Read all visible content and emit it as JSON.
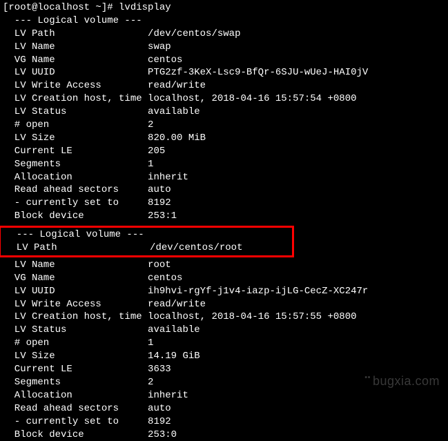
{
  "prompt": "[root@localhost ~]# ",
  "command": "lvdisplay",
  "volumes": [
    {
      "header": "  --- Logical volume ---",
      "fields": [
        {
          "label": "  LV Path               ",
          "value": "/dev/centos/swap"
        },
        {
          "label": "  LV Name               ",
          "value": "swap"
        },
        {
          "label": "  VG Name               ",
          "value": "centos"
        },
        {
          "label": "  LV UUID               ",
          "value": "PTG2zf-3KeX-Lsc9-BfQr-6SJU-wUeJ-HAI0jV"
        },
        {
          "label": "  LV Write Access       ",
          "value": "read/write"
        },
        {
          "label": "  LV Creation host, time",
          "value": "localhost, 2018-04-16 15:57:54 +0800"
        },
        {
          "label": "  LV Status             ",
          "value": "available"
        },
        {
          "label": "  # open                ",
          "value": "2"
        },
        {
          "label": "  LV Size               ",
          "value": "820.00 MiB"
        },
        {
          "label": "  Current LE            ",
          "value": "205"
        },
        {
          "label": "  Segments              ",
          "value": "1"
        },
        {
          "label": "  Allocation            ",
          "value": "inherit"
        },
        {
          "label": "  Read ahead sectors    ",
          "value": "auto"
        },
        {
          "label": "  - currently set to    ",
          "value": "8192"
        },
        {
          "label": "  Block device          ",
          "value": "253:1"
        }
      ]
    },
    {
      "header": "  --- Logical volume ---",
      "highlighted_field": {
        "label": "  LV Path               ",
        "value": "/dev/centos/root"
      },
      "fields": [
        {
          "label": "  LV Name               ",
          "value": "root"
        },
        {
          "label": "  VG Name               ",
          "value": "centos"
        },
        {
          "label": "  LV UUID               ",
          "value": "ih9hvi-rgYf-j1v4-iazp-ijLG-CecZ-XC247r"
        },
        {
          "label": "  LV Write Access       ",
          "value": "read/write"
        },
        {
          "label": "  LV Creation host, time",
          "value": "localhost, 2018-04-16 15:57:55 +0800"
        },
        {
          "label": "  LV Status             ",
          "value": "available"
        },
        {
          "label": "  # open                ",
          "value": "1"
        },
        {
          "label": "  LV Size               ",
          "value": "14.19 GiB"
        },
        {
          "label": "  Current LE            ",
          "value": "3633"
        },
        {
          "label": "  Segments              ",
          "value": "2"
        },
        {
          "label": "  Allocation            ",
          "value": "inherit"
        },
        {
          "label": "  Read ahead sectors    ",
          "value": "auto"
        },
        {
          "label": "  - currently set to    ",
          "value": "8192"
        },
        {
          "label": "  Block device          ",
          "value": "253:0"
        }
      ]
    }
  ],
  "watermark": "bugxia.com"
}
